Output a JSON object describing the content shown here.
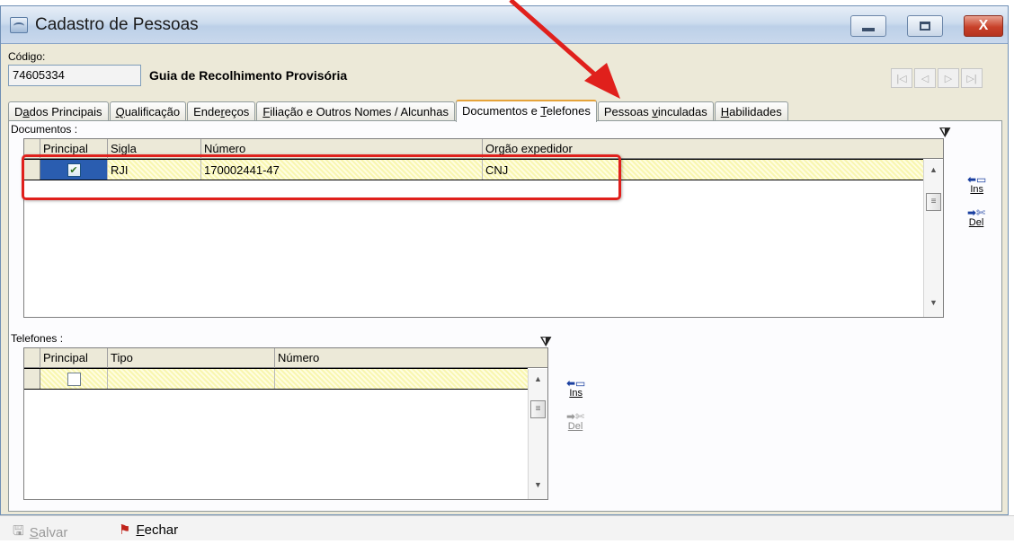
{
  "window": {
    "title": "Cadastro de Pessoas",
    "minimize_glyph": "",
    "maximize_glyph": "",
    "close_glyph": "X"
  },
  "header": {
    "codigo_label": "Código:",
    "codigo_value": "74605334",
    "record_name": "Guia de Recolhimento Provisória",
    "nav": [
      "|◁",
      "◁",
      "▷",
      "▷|"
    ]
  },
  "tabs": [
    {
      "pre": "D",
      "u": "a",
      "post": "dos Principais"
    },
    {
      "pre": "",
      "u": "Q",
      "post": "ualificação"
    },
    {
      "pre": "Ende",
      "u": "r",
      "post": "eços"
    },
    {
      "pre": "",
      "u": "F",
      "post": "iliação e Outros Nomes / Alcunhas"
    },
    {
      "pre": "Documentos e ",
      "u": "T",
      "post": "elefones"
    },
    {
      "pre": "Pessoas ",
      "u": "v",
      "post": "inculadas"
    },
    {
      "pre": "",
      "u": "H",
      "post": "abilidades"
    }
  ],
  "documentos": {
    "section_label": "Documentos :",
    "columns": [
      "Principal",
      "Sigla",
      "Número",
      "Orgão expedidor"
    ],
    "rows": [
      {
        "principal": true,
        "sigla": "RJI",
        "numero": "170002441-47",
        "orgao": "CNJ"
      }
    ],
    "ins_label": "Ins",
    "del_label": "Del"
  },
  "telefones": {
    "section_label": "Telefones :",
    "columns": [
      "Principal",
      "Tipo",
      "Número"
    ],
    "rows": [
      {
        "principal": false,
        "tipo": "",
        "numero": ""
      }
    ],
    "ins_label": "Ins",
    "del_label": "Del"
  },
  "bottombar": {
    "salvar_u": "S",
    "salvar_rest": "alvar",
    "fechar_u": "F",
    "fechar_rest": "echar"
  },
  "colors": {
    "annotation_red": "#e0201c",
    "selected_row_yellow": "#f8f6b0",
    "active_tab_accent": "#e5a33b"
  }
}
